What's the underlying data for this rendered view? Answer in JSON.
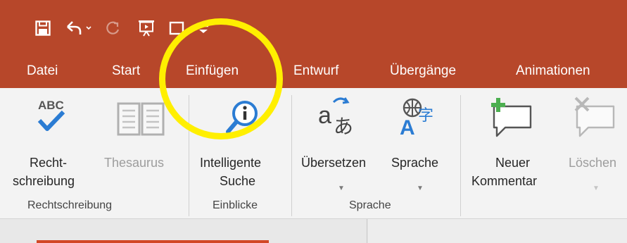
{
  "quick_access": {
    "items": [
      {
        "name": "save-icon",
        "disabled": false
      },
      {
        "name": "undo-icon",
        "disabled": false
      },
      {
        "name": "redo-icon",
        "disabled": true
      },
      {
        "name": "start-from-beginning-icon",
        "disabled": false
      },
      {
        "name": "presentation-icon",
        "disabled": false
      },
      {
        "name": "customize-qat-icon",
        "disabled": false
      }
    ]
  },
  "tabs": [
    "Datei",
    "Start",
    "Einfügen",
    "Entwurf",
    "Übergänge",
    "Animationen"
  ],
  "ribbon": {
    "buttons": {
      "spelling": {
        "line1": "Recht-",
        "line2": "schreibung",
        "icon": "abc-check-icon"
      },
      "thesaurus": {
        "line1": "Thesaurus",
        "icon": "book-icon",
        "disabled": true
      },
      "smart_lookup": {
        "line1": "Intelligente",
        "line2": "Suche",
        "icon": "smart-lookup-icon"
      },
      "translate": {
        "line1": "Übersetzen",
        "icon": "translate-icon",
        "has_dropdown": true
      },
      "language": {
        "line1": "Sprache",
        "icon": "language-icon",
        "has_dropdown": true
      },
      "new_comment": {
        "line1": "Neuer",
        "line2": "Kommentar",
        "icon": "new-comment-icon"
      },
      "delete_comment": {
        "line1": "Löschen",
        "icon": "delete-comment-icon",
        "disabled": true,
        "has_dropdown": true
      }
    },
    "groups": {
      "proofing": "Rechtschreibung",
      "insights": "Einblicke",
      "language": "Sprache"
    }
  },
  "colors": {
    "titlebar": "#b7472a",
    "ribbon_bg": "#f3f3f3",
    "highlight": "#ffef00",
    "accent_blue": "#2b7cd3",
    "comment_green": "#4caf50"
  },
  "annotation": {
    "type": "highlight-circle",
    "target": "Einfügen"
  }
}
